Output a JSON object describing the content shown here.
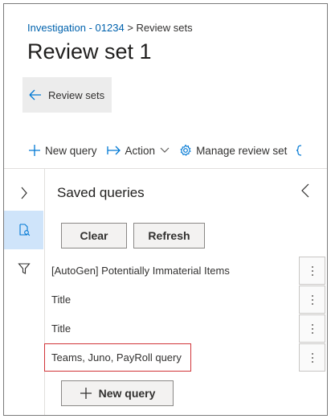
{
  "breadcrumb": {
    "link": "Investigation - 01234",
    "separator": " > ",
    "current": "Review sets"
  },
  "page": {
    "title": "Review set 1"
  },
  "back_button": {
    "label": "Review sets"
  },
  "commands": {
    "new_query": "New query",
    "action": "Action",
    "manage": "Manage review set"
  },
  "panel": {
    "title": "Saved queries",
    "clear_label": "Clear",
    "refresh_label": "Refresh",
    "queries": [
      {
        "label": "[AutoGen] Potentially Immaterial Items"
      },
      {
        "label": "Title"
      },
      {
        "label": "Title"
      },
      {
        "label": "Teams, Juno, PayRoll query"
      }
    ],
    "new_query_label": "New query"
  },
  "colors": {
    "link": "#0062ad",
    "accent": "#0078d4",
    "active_rail": "#cfe4fa",
    "highlight_border": "#d13438"
  }
}
